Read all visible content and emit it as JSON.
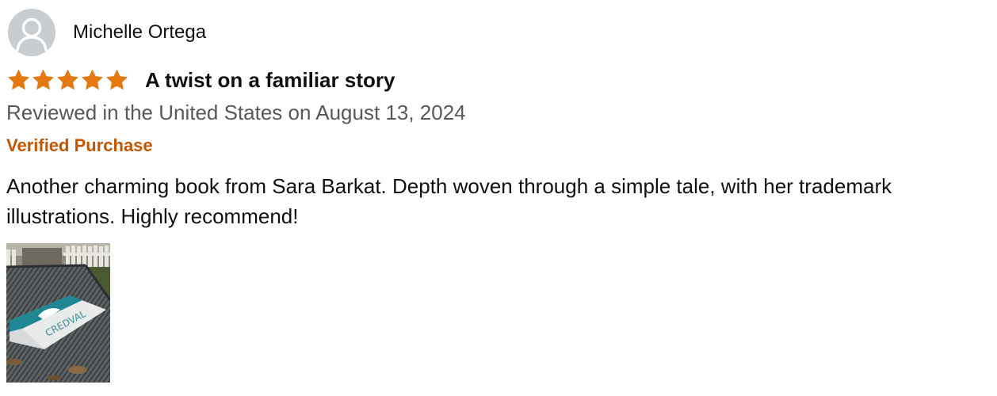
{
  "reviewer": {
    "name": "Michelle Ortega",
    "avatar_icon": "default-user-avatar-icon"
  },
  "rating": {
    "stars": 5,
    "max_stars": 5,
    "star_color": "#e47911"
  },
  "review": {
    "title": "A twist on a familiar story",
    "meta": "Reviewed in the United States on August 13, 2024",
    "verified_label": "Verified Purchase",
    "body": "Another charming book from Sara Barkat. Depth woven through a simple tale, with her trademark illustrations. Highly recommend!"
  },
  "photo": {
    "book_cover_text": "CREDVAL"
  },
  "colors": {
    "verified": "#c45500",
    "meta": "#565959",
    "text": "#0f1111",
    "avatar_bg": "#c8cdd1"
  }
}
